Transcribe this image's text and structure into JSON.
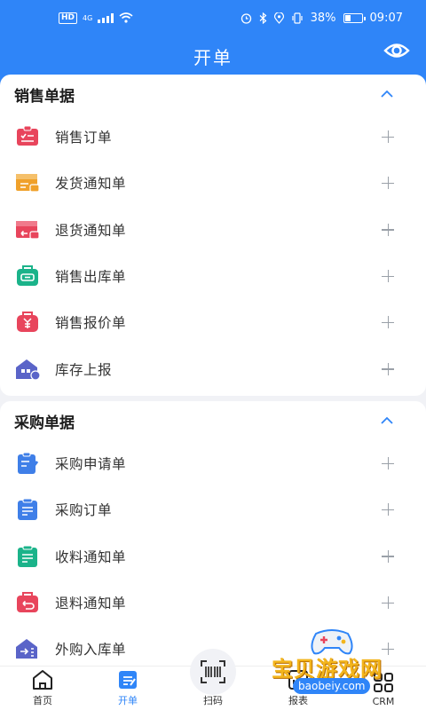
{
  "status_bar": {
    "left_badges": [
      "HD",
      "4G"
    ],
    "right_text": "38%",
    "time": "09:07"
  },
  "header": {
    "title": "开单",
    "eye_icon": "eye-icon"
  },
  "sections": [
    {
      "title": "销售单据",
      "items": [
        {
          "label": "销售订单",
          "icon": "sales-order-icon",
          "color": "#e8455c"
        },
        {
          "label": "发货通知单",
          "icon": "delivery-notice-icon",
          "color": "#f0a12b"
        },
        {
          "label": "退货通知单",
          "icon": "return-notice-icon",
          "color": "#e8455c"
        },
        {
          "label": "销售出库单",
          "icon": "sales-outbound-icon",
          "color": "#1bb38a"
        },
        {
          "label": "销售报价单",
          "icon": "sales-quote-icon",
          "color": "#e8455c"
        },
        {
          "label": "库存上报",
          "icon": "stock-report-icon",
          "color": "#5a64c8"
        }
      ]
    },
    {
      "title": "采购单据",
      "items": [
        {
          "label": "采购申请单",
          "icon": "purchase-request-icon",
          "color": "#3f7fe8"
        },
        {
          "label": "采购订单",
          "icon": "purchase-order-icon",
          "color": "#3f7fe8"
        },
        {
          "label": "收料通知单",
          "icon": "receipt-notice-icon",
          "color": "#1bb38a"
        },
        {
          "label": "退料通知单",
          "icon": "material-return-icon",
          "color": "#e8455c"
        },
        {
          "label": "外购入库单",
          "icon": "purchase-inbound-icon",
          "color": "#5a64c8"
        }
      ]
    }
  ],
  "nav": [
    {
      "label": "首页",
      "icon": "home-icon",
      "active": false
    },
    {
      "label": "开单",
      "icon": "order-icon",
      "active": true
    },
    {
      "label": "扫码",
      "icon": "scan-icon",
      "active": false
    },
    {
      "label": "报表",
      "icon": "report-icon",
      "active": false
    },
    {
      "label": "CRM",
      "icon": "crm-icon",
      "active": false
    }
  ],
  "watermark": {
    "text": "宝贝游戏网",
    "url": "baobeiy.com"
  },
  "colors": {
    "primary": "#2f85f8",
    "background": "#f1f2f6"
  }
}
